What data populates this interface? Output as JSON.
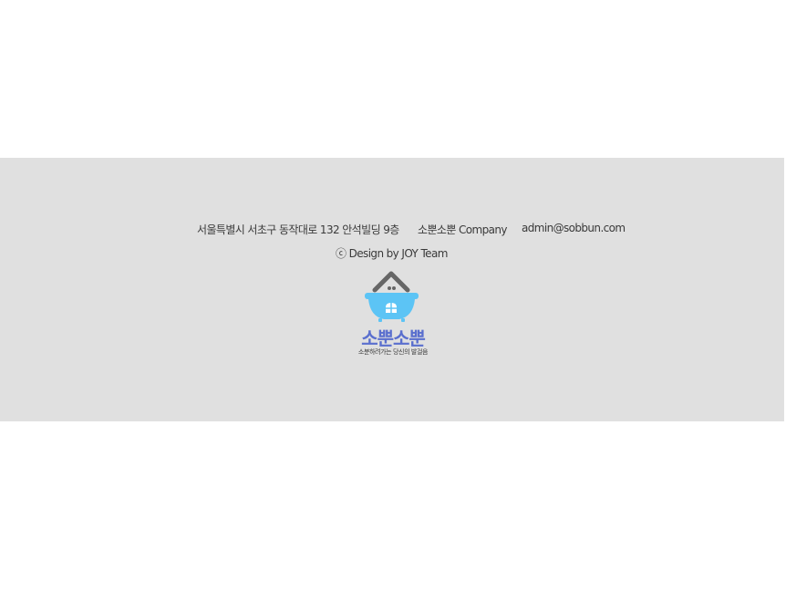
{
  "footer": {
    "address": "서울특별시 서초구 동작대로 132 안석빌딩 9층",
    "company": "소뿐소뿐 Company",
    "email": "admin@sobbun.com",
    "credit": "ⓒ Design by JOY Team",
    "logo": {
      "icon": "house-bathtub-icon",
      "name": "소뿐소뿐",
      "tagline": "소분하려가는 당신의 발걸음",
      "colors": {
        "roof": "#666666",
        "tub": "#5cc4f5",
        "name": "#5a6fce"
      }
    }
  },
  "colors": {
    "footer_background": "#e0e0e0",
    "page_background": "#ffffff",
    "text": "#3a3a3a"
  }
}
